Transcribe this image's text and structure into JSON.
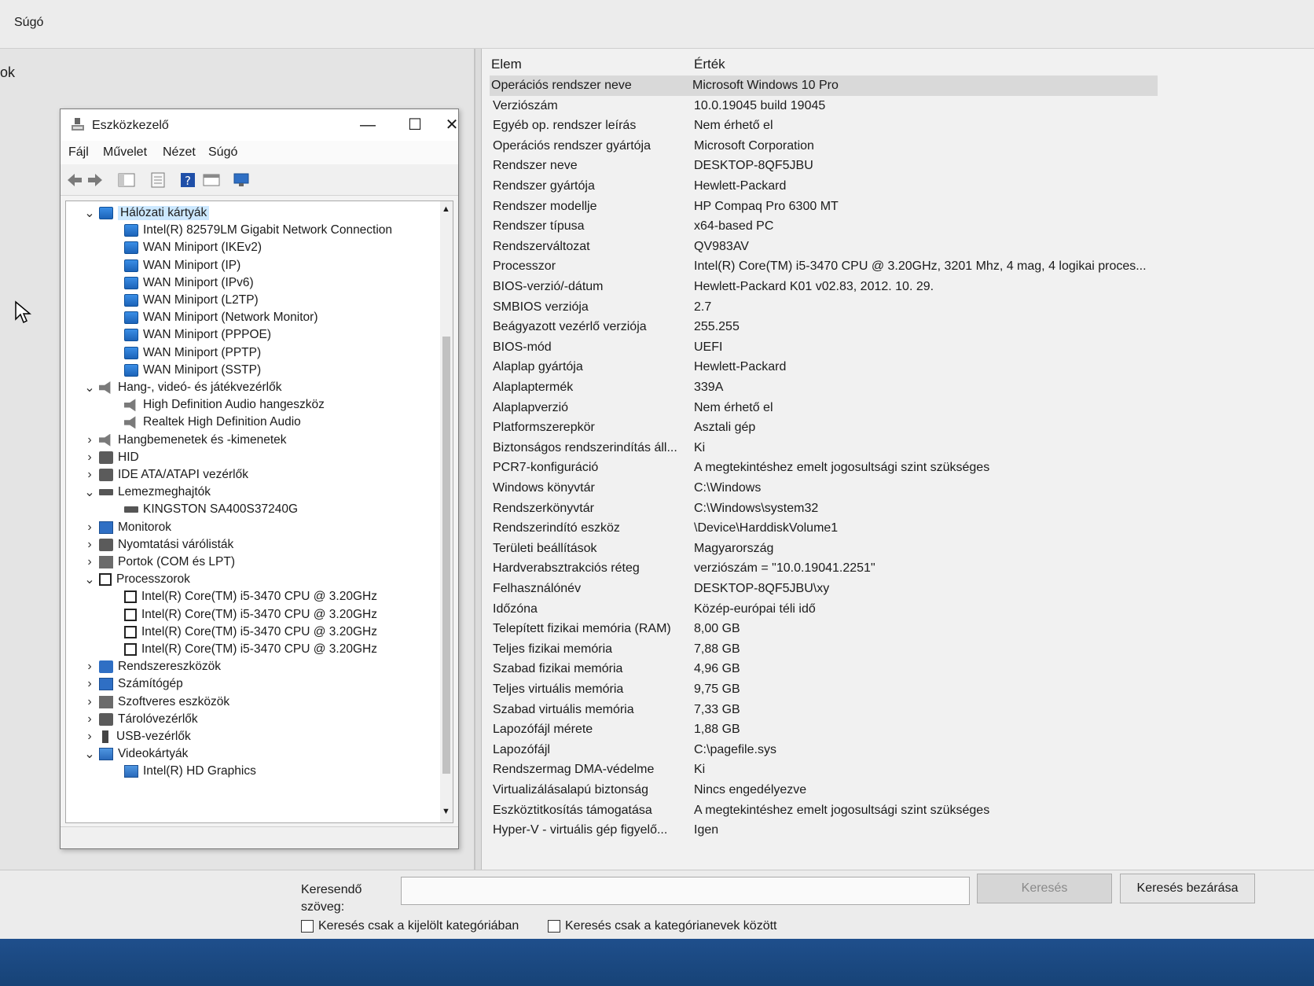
{
  "sysinfo": {
    "menu_help": "Súgó",
    "tree_edge_text": "ok",
    "header": {
      "item": "Elem",
      "value": "Érték"
    },
    "rows": [
      {
        "item": "Operációs rendszer neve",
        "value": "Microsoft Windows 10 Pro"
      },
      {
        "item": "Verziószám",
        "value": "10.0.19045 build 19045"
      },
      {
        "item": "Egyéb op. rendszer leírás",
        "value": "Nem érhető el"
      },
      {
        "item": "Operációs rendszer gyártója",
        "value": "Microsoft Corporation"
      },
      {
        "item": "Rendszer neve",
        "value": "DESKTOP-8QF5JBU"
      },
      {
        "item": "Rendszer gyártója",
        "value": "Hewlett-Packard"
      },
      {
        "item": "Rendszer modellje",
        "value": "HP Compaq Pro 6300 MT"
      },
      {
        "item": "Rendszer típusa",
        "value": "x64-based PC"
      },
      {
        "item": "Rendszerváltozat",
        "value": "QV983AV"
      },
      {
        "item": "Processzor",
        "value": "Intel(R) Core(TM) i5-3470 CPU @ 3.20GHz, 3201 Mhz, 4 mag, 4 logikai proces..."
      },
      {
        "item": "BIOS-verzió/-dátum",
        "value": "Hewlett-Packard K01 v02.83, 2012. 10. 29."
      },
      {
        "item": "SMBIOS verziója",
        "value": "2.7"
      },
      {
        "item": "Beágyazott vezérlő verziója",
        "value": "255.255"
      },
      {
        "item": "BIOS-mód",
        "value": "UEFI"
      },
      {
        "item": "Alaplap gyártója",
        "value": "Hewlett-Packard"
      },
      {
        "item": "Alaplaptermék",
        "value": "339A"
      },
      {
        "item": "Alaplapverzió",
        "value": "Nem érhető el"
      },
      {
        "item": "Platformszerepkör",
        "value": "Asztali gép"
      },
      {
        "item": "Biztonságos rendszerindítás áll...",
        "value": "Ki"
      },
      {
        "item": "PCR7-konfiguráció",
        "value": "A megtekintéshez emelt jogosultsági szint szükséges"
      },
      {
        "item": "Windows könyvtár",
        "value": "C:\\Windows"
      },
      {
        "item": "Rendszerkönyvtár",
        "value": "C:\\Windows\\system32"
      },
      {
        "item": "Rendszerindító eszköz",
        "value": "\\Device\\HarddiskVolume1"
      },
      {
        "item": "Területi beállítások",
        "value": "Magyarország"
      },
      {
        "item": "Hardverabsztrakciós réteg",
        "value": "verziószám = \"10.0.19041.2251\""
      },
      {
        "item": "Felhasználónév",
        "value": "DESKTOP-8QF5JBU\\xy"
      },
      {
        "item": "Időzóna",
        "value": "Közép-európai téli idő"
      },
      {
        "item": "Telepített fizikai memória (RAM)",
        "value": "8,00 GB"
      },
      {
        "item": "Teljes fizikai memória",
        "value": "7,88 GB"
      },
      {
        "item": "Szabad fizikai memória",
        "value": "4,96 GB"
      },
      {
        "item": "Teljes virtuális memória",
        "value": "9,75 GB"
      },
      {
        "item": "Szabad virtuális memória",
        "value": "7,33 GB"
      },
      {
        "item": "Lapozófájl mérete",
        "value": "1,88 GB"
      },
      {
        "item": "Lapozófájl",
        "value": "C:\\pagefile.sys"
      },
      {
        "item": "Rendszermag DMA-védelme",
        "value": "Ki"
      },
      {
        "item": "Virtualizálásalapú biztonság",
        "value": "Nincs engedélyezve"
      },
      {
        "item": "Eszköztitkosítás támogatása",
        "value": "A megtekintéshez emelt jogosultsági szint szükséges"
      },
      {
        "item": "Hyper-V - virtuális gép figyelő...",
        "value": "Igen"
      }
    ],
    "search": {
      "label": "Keresendő szöveg:",
      "input_value": "",
      "search_button": "Keresés",
      "close_button": "Keresés bezárása",
      "checkbox_selected_category": "Keresés csak a kijelölt kategóriában",
      "checkbox_category_names": "Keresés csak a kategórianevek között"
    }
  },
  "devmgr": {
    "title": "Eszközkezelő",
    "controls": {
      "minimize": "—",
      "maximize": "☐",
      "close": "✕"
    },
    "menu": [
      "Fájl",
      "Művelet",
      "Nézet",
      "Súgó"
    ],
    "tree": [
      {
        "label": "Hálózati kártyák",
        "level": 0,
        "expander": "expanded",
        "icon": "network-adapter-icon",
        "selected": true
      },
      {
        "label": "Intel(R) 82579LM Gigabit Network Connection",
        "level": 1,
        "icon": "network-adapter-icon"
      },
      {
        "label": "WAN Miniport (IKEv2)",
        "level": 1,
        "icon": "network-adapter-icon"
      },
      {
        "label": "WAN Miniport (IP)",
        "level": 1,
        "icon": "network-adapter-icon"
      },
      {
        "label": "WAN Miniport (IPv6)",
        "level": 1,
        "icon": "network-adapter-icon"
      },
      {
        "label": "WAN Miniport (L2TP)",
        "level": 1,
        "icon": "network-adapter-icon"
      },
      {
        "label": "WAN Miniport (Network Monitor)",
        "level": 1,
        "icon": "network-adapter-icon"
      },
      {
        "label": "WAN Miniport (PPPOE)",
        "level": 1,
        "icon": "network-adapter-icon"
      },
      {
        "label": "WAN Miniport (PPTP)",
        "level": 1,
        "icon": "network-adapter-icon"
      },
      {
        "label": "WAN Miniport (SSTP)",
        "level": 1,
        "icon": "network-adapter-icon"
      },
      {
        "label": "Hang-, videó- és játékvezérlők",
        "level": 0,
        "expander": "expanded",
        "icon": "speaker-icon"
      },
      {
        "label": "High Definition Audio hangeszköz",
        "level": 1,
        "icon": "speaker-icon"
      },
      {
        "label": "Realtek High Definition Audio",
        "level": 1,
        "icon": "speaker-icon"
      },
      {
        "label": "Hangbemenetek és -kimenetek",
        "level": 0,
        "expander": "collapsed",
        "icon": "speaker-icon"
      },
      {
        "label": "HID",
        "level": 0,
        "expander": "collapsed",
        "icon": "keyboard-icon"
      },
      {
        "label": "IDE ATA/ATAPI vezérlők",
        "level": 0,
        "expander": "collapsed",
        "icon": "ide-controller-icon"
      },
      {
        "label": "Lemezmeghajtók",
        "level": 0,
        "expander": "expanded",
        "icon": "disk-drive-icon"
      },
      {
        "label": "KINGSTON SA400S37240G",
        "level": 1,
        "icon": "disk-drive-icon"
      },
      {
        "label": "Monitorok",
        "level": 0,
        "expander": "collapsed",
        "icon": "monitor-icon"
      },
      {
        "label": "Nyomtatási várólisták",
        "level": 0,
        "expander": "collapsed",
        "icon": "printer-icon"
      },
      {
        "label": "Portok (COM és LPT)",
        "level": 0,
        "expander": "collapsed",
        "icon": "port-icon"
      },
      {
        "label": "Processzorok",
        "level": 0,
        "expander": "expanded",
        "icon": "processor-icon"
      },
      {
        "label": "Intel(R) Core(TM) i5-3470 CPU @ 3.20GHz",
        "level": 1,
        "icon": "processor-icon"
      },
      {
        "label": "Intel(R) Core(TM) i5-3470 CPU @ 3.20GHz",
        "level": 1,
        "icon": "processor-icon"
      },
      {
        "label": "Intel(R) Core(TM) i5-3470 CPU @ 3.20GHz",
        "level": 1,
        "icon": "processor-icon"
      },
      {
        "label": "Intel(R) Core(TM) i5-3470 CPU @ 3.20GHz",
        "level": 1,
        "icon": "processor-icon"
      },
      {
        "label": "Rendszereszközök",
        "level": 0,
        "expander": "collapsed",
        "icon": "system-device-icon"
      },
      {
        "label": "Számítógép",
        "level": 0,
        "expander": "collapsed",
        "icon": "computer-icon"
      },
      {
        "label": "Szoftveres eszközök",
        "level": 0,
        "expander": "collapsed",
        "icon": "software-device-icon"
      },
      {
        "label": "Tárolóvezérlők",
        "level": 0,
        "expander": "collapsed",
        "icon": "storage-controller-icon"
      },
      {
        "label": "USB-vezérlők",
        "level": 0,
        "expander": "collapsed",
        "icon": "usb-icon"
      },
      {
        "label": "Videokártyák",
        "level": 0,
        "expander": "expanded",
        "icon": "display-adapter-icon"
      },
      {
        "label": "Intel(R) HD Graphics",
        "level": 1,
        "icon": "display-adapter-icon"
      }
    ],
    "toolbar_icons": [
      "back-arrow-icon",
      "forward-arrow-icon",
      "show-hide-console-tree-icon",
      "properties-icon",
      "help-icon",
      "view-icon",
      "scan-hardware-icon"
    ]
  },
  "colors": {
    "taskbar": "#1f4f8c",
    "selection": "#cce8ff",
    "network_icon": "#2f6fc4"
  }
}
